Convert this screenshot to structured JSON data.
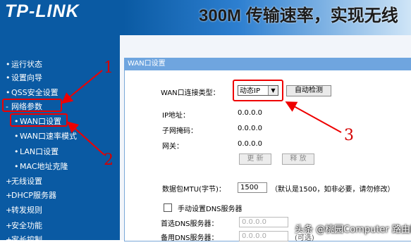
{
  "header": {
    "logo": "TP-LINK",
    "slogan": "300M 传输速率，实现无线"
  },
  "sidebar": {
    "items": [
      {
        "label": "运行状态",
        "bullet": "•"
      },
      {
        "label": "设置向导",
        "bullet": "•"
      },
      {
        "label": "QSS安全设置",
        "bullet": "•"
      },
      {
        "label": "网络参数",
        "bullet": "-"
      },
      {
        "label": "WAN口设置",
        "bullet": "•"
      },
      {
        "label": "WAN口速率模式",
        "bullet": "•"
      },
      {
        "label": "LAN口设置",
        "bullet": "•"
      },
      {
        "label": "MAC地址克隆",
        "bullet": "•"
      },
      {
        "label": "无线设置",
        "bullet": "+"
      },
      {
        "label": "DHCP服务器",
        "bullet": "+"
      },
      {
        "label": "转发规则",
        "bullet": "+"
      },
      {
        "label": "安全功能",
        "bullet": "+"
      },
      {
        "label": "家长控制",
        "bullet": "+"
      }
    ]
  },
  "panel": {
    "title": "WAN口设置",
    "conn_type_label": "WAN口连接类型：",
    "conn_type_value": "动态IP",
    "auto_detect_button": "自动检测",
    "ip_label": "IP地址：",
    "ip_value": "0.0.0.0",
    "mask_label": "子网掩码：",
    "mask_value": "0.0.0.0",
    "gateway_label": "网关：",
    "gateway_value": "0.0.0.0",
    "renew_button": "更 新",
    "release_button": "释 放",
    "mtu_label": "数据包MTU(字节)：",
    "mtu_value": "1500",
    "mtu_hint": "（默认是1500，如非必要，请勿修改）",
    "dns_checkbox_label": "手动设置DNS服务器",
    "dns1_label": "首选DNS服务器：",
    "dns1_value": "0.0.0.0",
    "dns2_label": "备用DNS服务器：",
    "dns2_value": "0.0.0.0",
    "dns2_hint": "(可选)"
  },
  "annotations": {
    "n1": "1",
    "n2": "2",
    "n3": "3",
    "color": "#e00000"
  },
  "watermark": "头条 @桃园Computer 路由网"
}
